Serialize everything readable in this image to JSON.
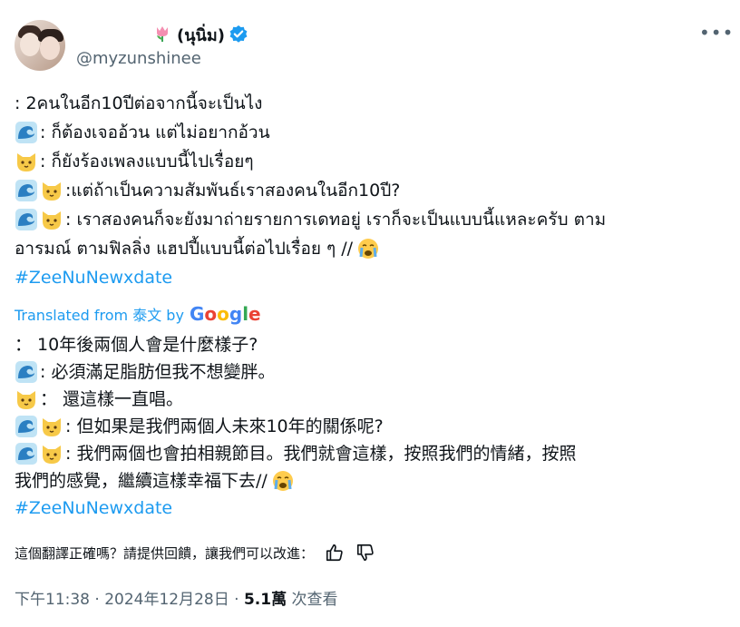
{
  "header": {
    "display_name": "(นุนิ่ม)",
    "handle": "@myzunshinee",
    "more_label": "•••"
  },
  "original": {
    "lines": [
      ": 2คนในอีก10ปีต่อจากนี้จะเป็นไง",
      ": ก็ต้องเจออ้วน แต่ไม่อยากอ้วน",
      ": ก็ยังร้องเพลงแบบนี้ไปเรื่อยๆ",
      ":แต่ถ้าเป็นความสัมพันธ์เราสองคนในอีก10ปี?",
      " : เราสองคนก็จะยังมาถ่ายรายการเดทอยู่ เราก็จะเป็นแบบนี้แหละครับ ตาม",
      "อารมณ์ ตามฟิลลิ่ง แฮปปี้แบบนี้ต่อไปเรื่อย ๆ //"
    ],
    "hashtag": "#ZeeNuNewxdate"
  },
  "translation": {
    "label": "Translated from 泰文 by",
    "google": [
      "G",
      "o",
      "o",
      "g",
      "l",
      "e"
    ],
    "lines": [
      "：  10年後兩個人會是什麼樣子?",
      " : 必須滿足脂肪但我不想變胖。",
      "：  還這樣一直唱。",
      " : 但如果是我們兩個人未來10年的關係呢?",
      " : 我們兩個也會拍相親節目。我們就會這樣，按照我們的情緒，按照",
      "我們的感覺，繼續這樣幸福下去//"
    ],
    "hashtag": "#ZeeNuNewxdate"
  },
  "feedback": {
    "question": "這個翻譯正確嗎？請提供回饋，讓我們可以改進："
  },
  "meta": {
    "time": "下午11:38 · 2024年12月28日 · ",
    "views_count": "5.1萬",
    "views_label": " 次查看"
  },
  "colors": {
    "link": "#1d9bf0",
    "secondary_text": "#536471",
    "verified": "#1d9bf0"
  }
}
